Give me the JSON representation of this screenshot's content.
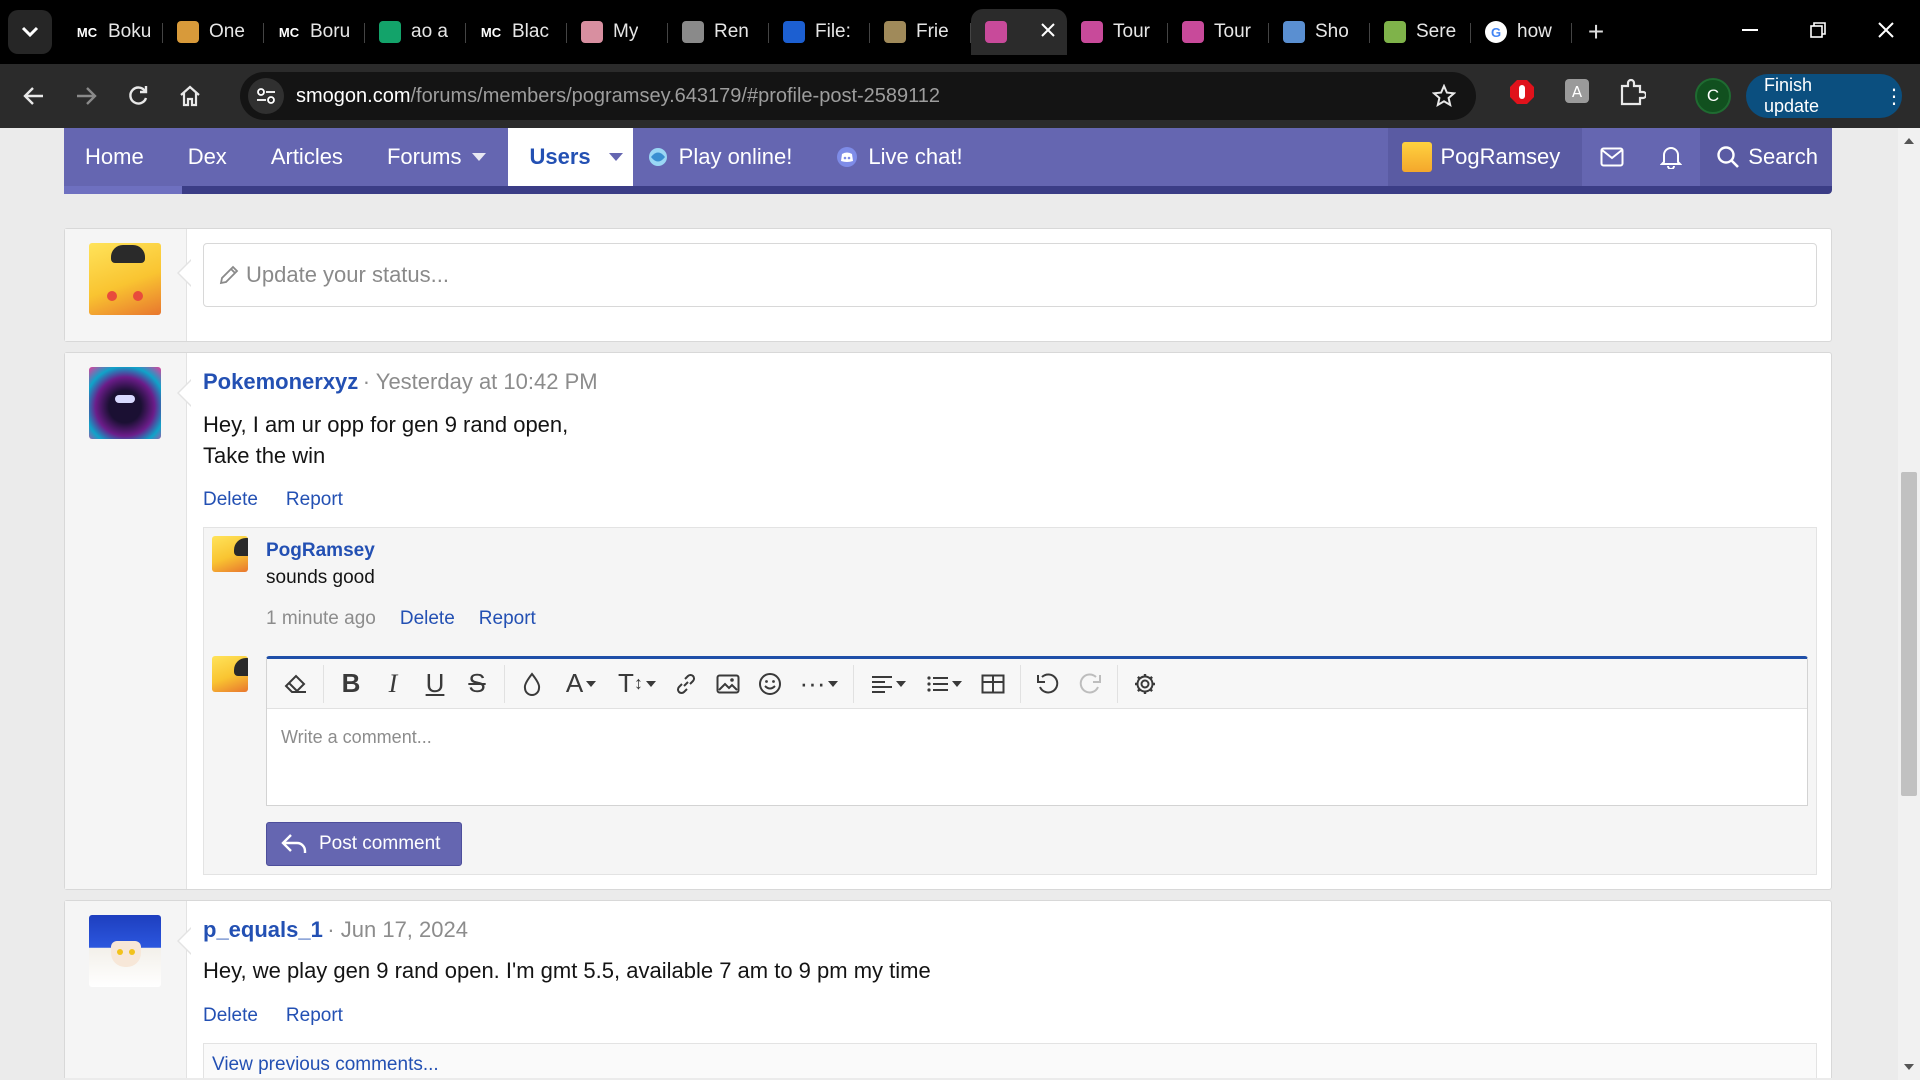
{
  "browser": {
    "tabs": [
      {
        "title": "Boku",
        "fav_text": "MC",
        "fav_color": "#000000"
      },
      {
        "title": "One",
        "fav_text": "",
        "fav_color": "#d89a3a"
      },
      {
        "title": "Boru",
        "fav_text": "MC",
        "fav_color": "#000000"
      },
      {
        "title": "ao a",
        "fav_text": "",
        "fav_color": "#13a36a"
      },
      {
        "title": "Blac",
        "fav_text": "MC",
        "fav_color": "#000000"
      },
      {
        "title": "My",
        "fav_text": "",
        "fav_color": "#d88fa0"
      },
      {
        "title": "Ren",
        "fav_text": "",
        "fav_color": "#8a8a8a"
      },
      {
        "title": "File:",
        "fav_text": "",
        "fav_color": "#1c5fd1"
      },
      {
        "title": "Frie",
        "fav_text": "",
        "fav_color": "#a08a5a"
      },
      {
        "title": "",
        "fav_text": "",
        "fav_color": "#c84a9a",
        "active": true
      },
      {
        "title": "Tour",
        "fav_text": "",
        "fav_color": "#c84a9a"
      },
      {
        "title": "Tour",
        "fav_text": "",
        "fav_color": "#c84a9a"
      },
      {
        "title": "Sho",
        "fav_text": "",
        "fav_color": "#5a8fd1"
      },
      {
        "title": "Sere",
        "fav_text": "",
        "fav_color": "#7fb34a"
      },
      {
        "title": "how",
        "fav_text": "G",
        "fav_color": "#ffffff"
      }
    ],
    "url_host": "smogon.com",
    "url_path": "/forums/members/pogramsey.643179/#profile-post-2589112",
    "profile_initial": "C",
    "finish_update": "Finish update"
  },
  "nav": {
    "home": "Home",
    "dex": "Dex",
    "articles": "Articles",
    "forums": "Forums",
    "users": "Users",
    "play": "Play online!",
    "chat": "Live chat!",
    "username": "PogRamsey",
    "search": "Search"
  },
  "status": {
    "placeholder": "Update your status..."
  },
  "posts": [
    {
      "author": "Pokemonerxyz",
      "time": "Yesterday at 10:42 PM",
      "line1": "Hey, I am ur opp for gen 9 rand open,",
      "line2": "Take the win",
      "delete": "Delete",
      "report": "Report",
      "comment": {
        "author": "PogRamsey",
        "text": "sounds good",
        "time": "1 minute ago",
        "delete": "Delete",
        "report": "Report"
      },
      "editor_placeholder": "Write a comment...",
      "post_button": "Post comment"
    },
    {
      "author": "p_equals_1",
      "time": "Jun 17, 2024",
      "line1": "Hey, we play gen 9 rand open. I'm gmt 5.5, available 7 am to 9 pm my time",
      "delete": "Delete",
      "report": "Report",
      "view_previous": "View previous comments..."
    }
  ],
  "colors": {
    "nav_bg": "#6566b1",
    "link": "#2350b3",
    "accent_border": "#1f4fa8"
  }
}
